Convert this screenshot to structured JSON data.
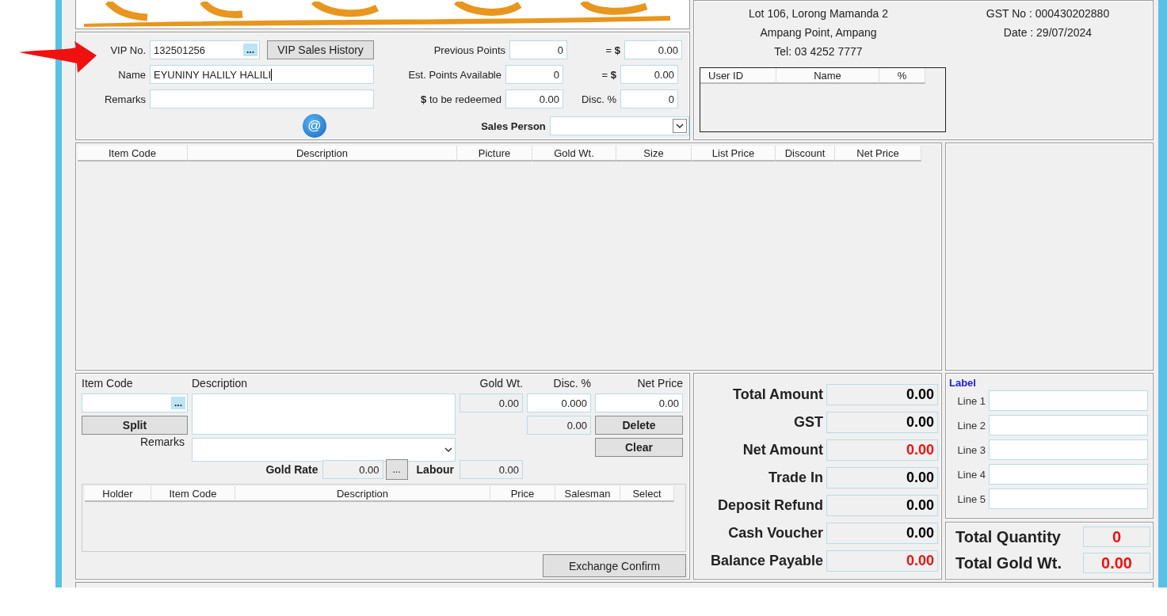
{
  "header": {
    "address_lines": [
      "Lot 106, Lorong Mamanda 2",
      "Ampang Point, Ampang",
      "Tel: 03 4252 7777"
    ],
    "info_lines": [
      "GST No : 000430202880",
      "Date : 29/07/2024"
    ]
  },
  "vip": {
    "vip_no_label": "VIP No.",
    "vip_no": "132501256",
    "lookup": "...",
    "history_button": "VIP Sales History",
    "name_label": "Name",
    "name": "EYUNINY HALILY HALILI",
    "remarks_label": "Remarks",
    "email_button": "@",
    "sales_person_label": "Sales Person",
    "points": [
      {
        "label": "Previous Points",
        "value": "0",
        "eq_label": "= **$**",
        "eq_value": "0.00"
      },
      {
        "label": "Est. Points Available",
        "value": "0",
        "eq_label": "= **$**",
        "eq_value": "0.00"
      },
      {
        "label": "**$**  to be redeemed",
        "value": "0.00",
        "eq_label": "Disc. %",
        "eq_value": "0"
      }
    ]
  },
  "user_table": {
    "columns": [
      "User ID",
      "Name",
      "%"
    ]
  },
  "items_table": {
    "columns": [
      "Item Code",
      "Description",
      "Picture",
      "Gold Wt.",
      "Size",
      "List Price",
      "Discount",
      "Net Price"
    ]
  },
  "entry": {
    "headers": [
      "Item Code",
      "Description",
      "Gold Wt.",
      "Disc. %",
      "Net Price"
    ],
    "lookup": "...",
    "gold_wt": {
      "value": "0.00",
      "disabled": true
    },
    "disc": {
      "value": "0.000",
      "disabled": false
    },
    "net_price": {
      "value": "0.00",
      "disabled": false
    },
    "disc_amount": {
      "value": "0.00",
      "disabled": true
    },
    "split_button": "Split",
    "delete_button": "Delete",
    "clear_button": "Clear",
    "remarks_label": "Remarks",
    "gold_rate_label": "Gold Rate",
    "gold_rate": {
      "value": "0.00",
      "disabled": true
    },
    "gold_rate_lookup": "...",
    "labour_label": "Labour",
    "labour": {
      "value": "0.00",
      "disabled": true
    },
    "exchange_columns": [
      "Holder",
      "Item Code",
      "Description",
      "Price",
      "Salesman",
      "Select"
    ],
    "exchange_button": "Exchange Confirm"
  },
  "totals": [
    {
      "label": "Total Amount",
      "value": "0.00",
      "color": "#000000"
    },
    {
      "label": "GST",
      "value": "0.00",
      "color": "#000000"
    },
    {
      "label": "Net Amount",
      "value": "0.00",
      "color": "#ee1111"
    },
    {
      "label": "Trade In",
      "value": "0.00",
      "color": "#000000"
    },
    {
      "label": "Deposit Refund",
      "value": "0.00",
      "color": "#000000"
    },
    {
      "label": "Cash Voucher",
      "value": "0.00",
      "color": "#000000"
    },
    {
      "label": "Balance Payable",
      "value": "0.00",
      "color": "#ee1111"
    }
  ],
  "labels": {
    "title": "Label",
    "lines": [
      "Line 1",
      "Line 2",
      "Line 3",
      "Line 4",
      "Line 5"
    ]
  },
  "summary": [
    {
      "label": "Total Quantity",
      "value": "0"
    },
    {
      "label": "Total Gold Wt.",
      "value": "0.00"
    }
  ]
}
